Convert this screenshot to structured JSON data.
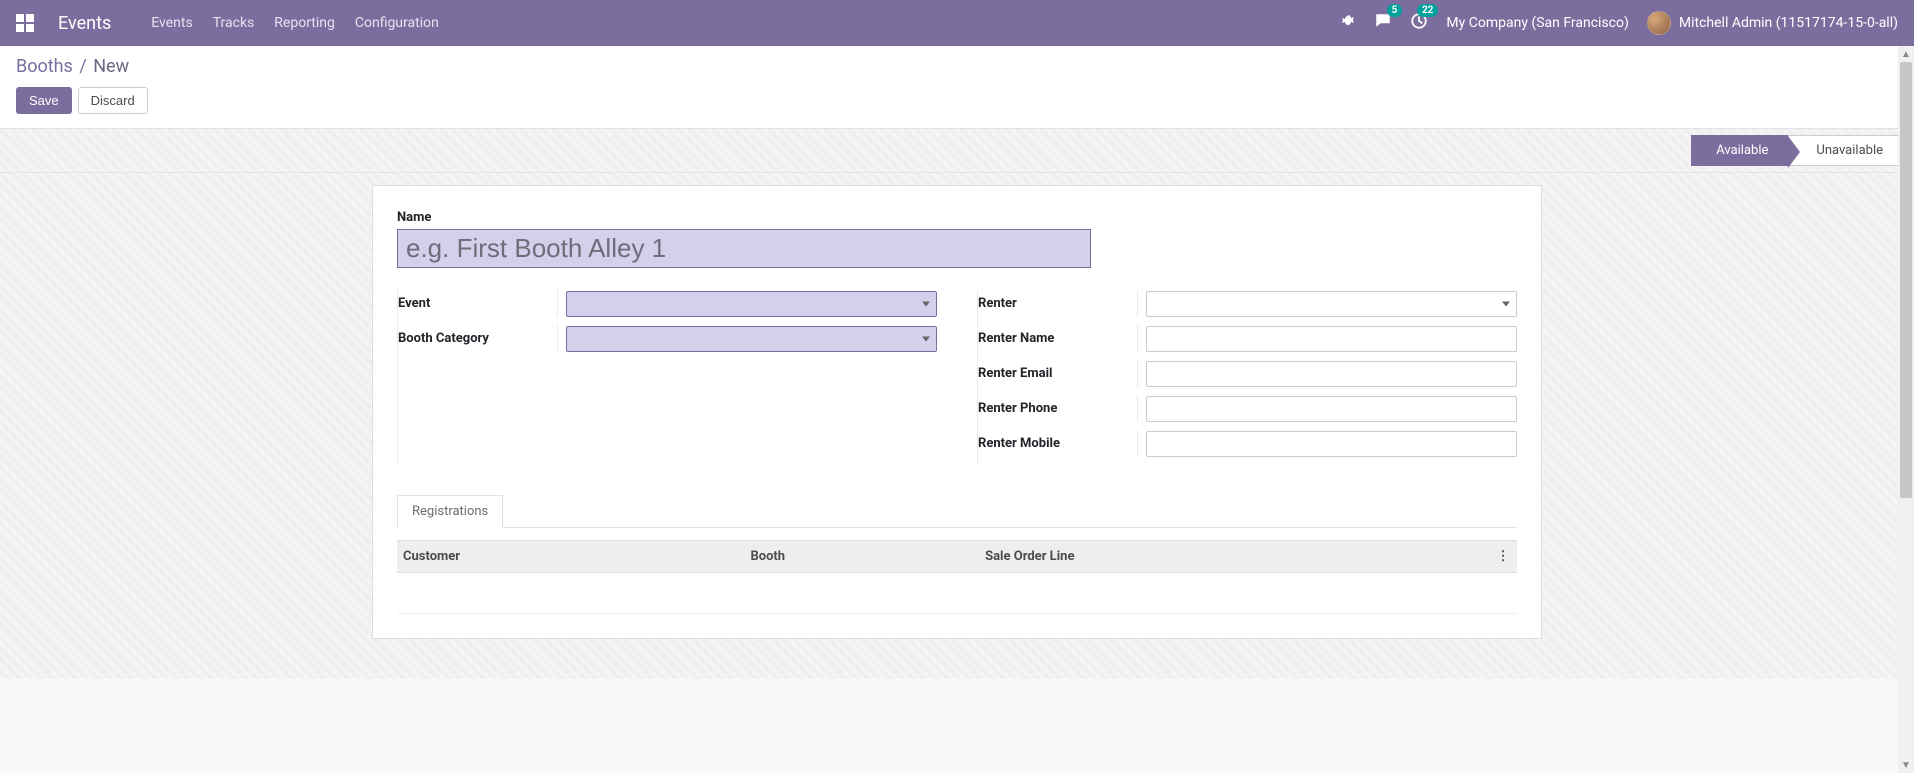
{
  "topnav": {
    "brand": "Events",
    "links": [
      "Events",
      "Tracks",
      "Reporting",
      "Configuration"
    ],
    "messaging_badge": "5",
    "activities_badge": "22",
    "company": "My Company (San Francisco)",
    "user": "Mitchell Admin (11517174-15-0-all)"
  },
  "breadcrumb": {
    "parent": "Booths",
    "sep": "/",
    "current": "New"
  },
  "buttons": {
    "save": "Save",
    "discard": "Discard"
  },
  "stages": {
    "available": "Available",
    "unavailable": "Unavailable"
  },
  "form": {
    "name_label": "Name",
    "name_placeholder": "e.g. First Booth Alley 1",
    "left": {
      "event_label": "Event",
      "booth_category_label": "Booth Category"
    },
    "right": {
      "renter_label": "Renter",
      "renter_name_label": "Renter Name",
      "renter_email_label": "Renter Email",
      "renter_phone_label": "Renter Phone",
      "renter_mobile_label": "Renter Mobile"
    }
  },
  "tabs": {
    "registrations": "Registrations"
  },
  "table": {
    "headers": {
      "customer": "Customer",
      "booth": "Booth",
      "sale_order_line": "Sale Order Line",
      "options": "⋮"
    }
  }
}
